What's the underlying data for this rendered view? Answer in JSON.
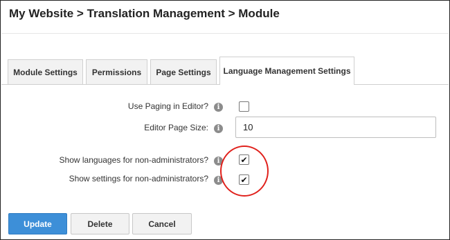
{
  "header": {
    "breadcrumb": "My Website > Translation Management > Module"
  },
  "tabs": [
    {
      "label": "Module Settings",
      "active": false
    },
    {
      "label": "Permissions",
      "active": false
    },
    {
      "label": "Page Settings",
      "active": false
    },
    {
      "label": "Language Management Settings",
      "active": true
    }
  ],
  "form": {
    "use_paging": {
      "label": "Use Paging in Editor?",
      "checked": false,
      "mark": ""
    },
    "page_size": {
      "label": "Editor Page Size:",
      "value": "10"
    },
    "show_languages": {
      "label": "Show languages for non-administrators?",
      "checked": true,
      "mark": "✔"
    },
    "show_settings": {
      "label": "Show settings for non-administrators?",
      "checked": true,
      "mark": "✔"
    },
    "info_glyph": "i"
  },
  "buttons": {
    "update": "Update",
    "delete": "Delete",
    "cancel": "Cancel"
  },
  "colors": {
    "primary_button": "#3d8fd8",
    "highlight_circle": "#e0201b"
  }
}
